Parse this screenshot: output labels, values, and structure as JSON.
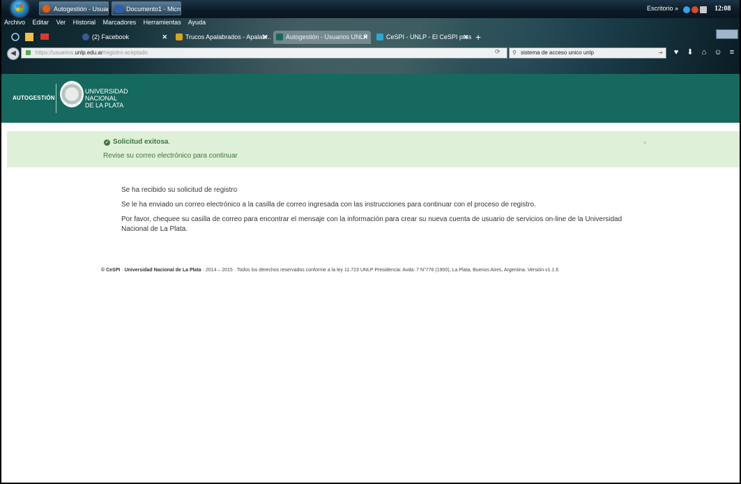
{
  "taskbar": {
    "buttons": [
      {
        "label": "Autogestión - Usuario...",
        "color": "#e66000"
      },
      {
        "label": "Documento1 - Microso...",
        "color": "#2b5fb3"
      }
    ],
    "tray_label": "Escritorio",
    "clock": "12:08 p.m"
  },
  "browser": {
    "menu": [
      "Archivo",
      "Editar",
      "Ver",
      "Historial",
      "Marcadores",
      "Herramientas",
      "Ayuda"
    ],
    "tabs": [
      {
        "label": "(2) Facebook",
        "close": "✕",
        "icon_color": "#3b5998"
      },
      {
        "label": "Trucos Apalabrados - Apalabr...",
        "close": "✕",
        "icon_color": "#d9a514"
      },
      {
        "label": "Autogestión - Usuarios UNLP",
        "close": "✕",
        "icon_color": "#15695f"
      },
      {
        "label": "CeSPI - UNLP - El CeSPI pres...",
        "close": "✕",
        "icon_color": "#2aa9d8"
      }
    ],
    "url": {
      "prefix": "https://usuarios.",
      "domain": "unlp.edu.ar",
      "path": "/registro-aceptado"
    },
    "search_value": "sistema de acceso unico unlp"
  },
  "site": {
    "brand": "AUTOGESTIÓN",
    "university": [
      "UNIVERSIDAD",
      "NACIONAL",
      "DE LA PLATA"
    ],
    "header_color": "#15695f"
  },
  "alert": {
    "title": "Solicitud exitosa",
    "title_suffix": ".",
    "text": "Revise su correo electrónico para continuar",
    "close": "×"
  },
  "content": {
    "paragraphs": [
      "Se ha recibido su solicitud de registro",
      "Se le ha enviado un correo electrónico a la casilla de correo ingresada con las instrucciones para continuar con el proceso de registro.",
      "Por favor, chequee su casilla de correo para encontrar el mensaje con la información para crear su nueva cuenta de usuario de servicios on-line de la Universidad Nacional de La Plata."
    ]
  },
  "footer": {
    "copyright": "© CeSPI",
    "sep1": " · ",
    "org": "Universidad Nacional de La Plata",
    "rest": " · 2014 – 2015 · Todos los derechos reservados conforme a la ley 11.723 UNLP Presidencia: Avda. 7 N°776 (1900), La Plata, Buenos Aires, Argentina. Versión v1.1.6"
  }
}
